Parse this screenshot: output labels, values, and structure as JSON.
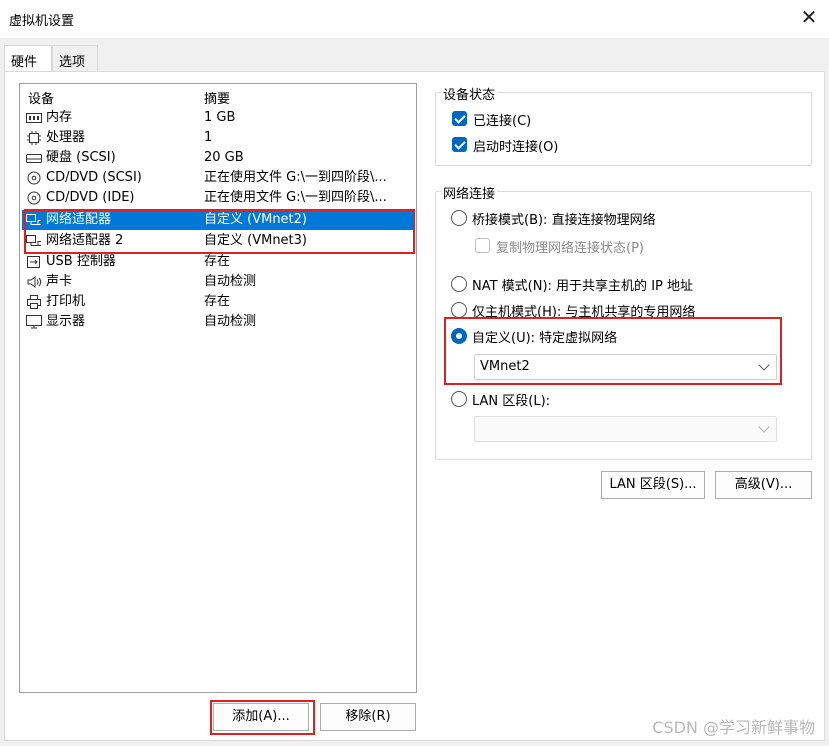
{
  "window": {
    "title": "虚拟机设置",
    "close_icon": "close-icon"
  },
  "tabs": [
    {
      "label": "硬件"
    },
    {
      "label": "选项"
    }
  ],
  "device_list": {
    "headers": {
      "device": "设备",
      "summary": "摘要"
    },
    "items": [
      {
        "icon": "memory-icon",
        "name": "内存",
        "summary": "1 GB"
      },
      {
        "icon": "processor-icon",
        "name": "处理器",
        "summary": "1"
      },
      {
        "icon": "harddisk-icon",
        "name": "硬盘 (SCSI)",
        "summary": "20 GB"
      },
      {
        "icon": "cd-dvd-icon",
        "name": "CD/DVD (SCSI)",
        "summary": "正在使用文件 G:\\一到四阶段\\..."
      },
      {
        "icon": "cd-dvd-icon",
        "name": "CD/DVD (IDE)",
        "summary": "正在使用文件 G:\\一到四阶段\\..."
      },
      {
        "icon": "network-adapter-icon",
        "name": "网络适配器",
        "summary": "自定义 (VMnet2)",
        "selected": true
      },
      {
        "icon": "network-adapter-icon",
        "name": "网络适配器 2",
        "summary": "自定义 (VMnet3)"
      },
      {
        "icon": "usb-icon",
        "name": "USB 控制器",
        "summary": "存在"
      },
      {
        "icon": "speaker-icon",
        "name": "声卡",
        "summary": "自动检测"
      },
      {
        "icon": "printer-icon",
        "name": "打印机",
        "summary": "存在"
      },
      {
        "icon": "display-icon",
        "name": "显示器",
        "summary": "自动检测"
      }
    ]
  },
  "buttons": {
    "add": "添加(A)...",
    "remove": "移除(R)",
    "lan_segments": "LAN 区段(S)...",
    "advanced": "高级(V)..."
  },
  "device_status": {
    "title": "设备状态",
    "connected": {
      "label": "已连接(C)",
      "checked": true
    },
    "connect_at_power_on": {
      "label": "启动时连接(O)",
      "checked": true
    }
  },
  "network_connection": {
    "title": "网络连接",
    "bridged": {
      "label": "桥接模式(B): 直接连接物理网络",
      "checked": false
    },
    "replicate": {
      "label": "复制物理网络连接状态(P)",
      "checked": false
    },
    "nat": {
      "label": "NAT 模式(N): 用于共享主机的 IP 地址",
      "checked": false
    },
    "host_only": {
      "label": "仅主机模式(H): 与主机共享的专用网络",
      "checked": false
    },
    "custom": {
      "label": "自定义(U): 特定虚拟网络",
      "checked": true,
      "selected_value": "VMnet2"
    },
    "lan_segment": {
      "label": "LAN 区段(L):",
      "checked": false,
      "selected_value": ""
    }
  },
  "watermark": "CSDN @学习新鲜事物",
  "colors": {
    "selection": "#0078d7",
    "accent": "#0067c0",
    "highlight_box": "#e02020"
  }
}
